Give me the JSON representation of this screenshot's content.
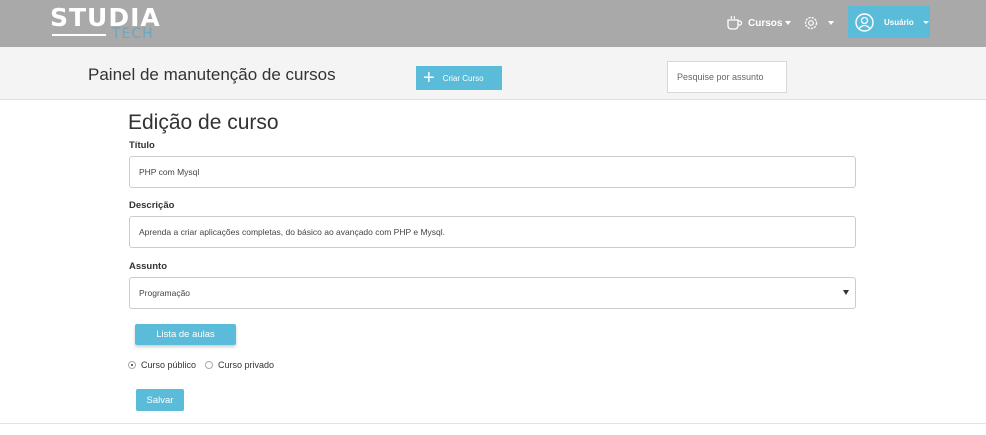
{
  "logo": {
    "main": "STUDIA",
    "sub": "TECH"
  },
  "navbar": {
    "cursos_label": "Cursos",
    "user_label": "Usuário"
  },
  "subheader": {
    "title": "Painel de manutenção de cursos",
    "create_button": "Criar Curso",
    "search_placeholder": "Pesquise por assunto"
  },
  "form": {
    "heading": "Edição de curso",
    "title_label": "Título",
    "title_value": "PHP com Mysql",
    "description_label": "Descrição",
    "description_value": "Aprenda a criar aplicações completas, do básico ao avançado com PHP e Mysql.",
    "subject_label": "Assunto",
    "subject_value": "Programação",
    "lessons_button": "Lista de aulas",
    "radio_public": "Curso público",
    "radio_private": "Curso privado",
    "public_selected": true,
    "save_button": "Salvar"
  },
  "colors": {
    "navbar": "#a9a9a9",
    "accent": "#5bbcd9",
    "subheader": "#f4f4f4"
  }
}
